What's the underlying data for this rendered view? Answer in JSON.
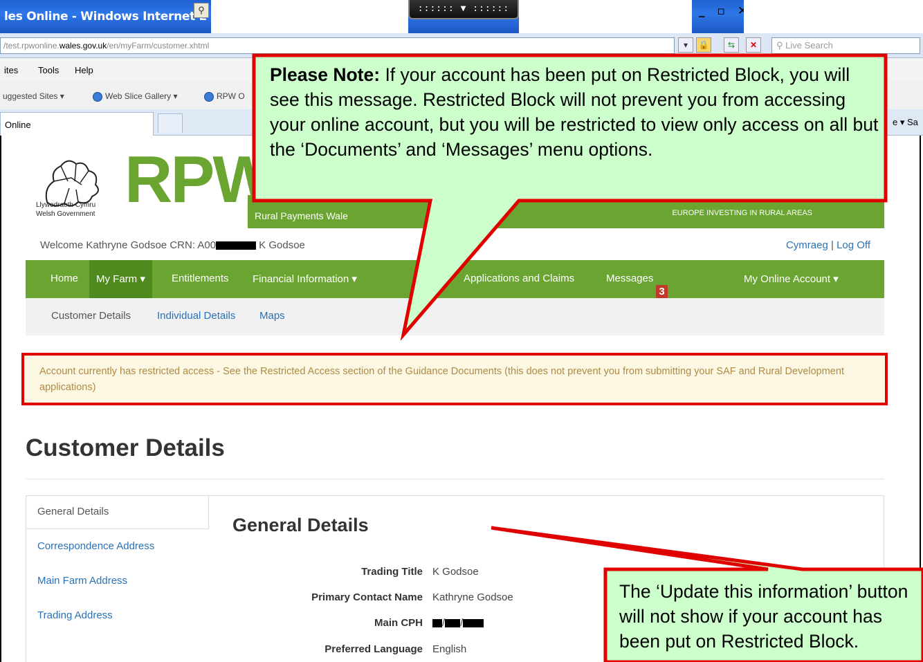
{
  "browser": {
    "window_title": "les Online - Windows Internet E",
    "window_controls": "_ ̈ ×",
    "rdp_bar": ":::::: ▼ ::::::",
    "url_prefix": "/test.rpwonline.",
    "url_domain": "wales.gov.uk",
    "url_suffix": "/en/myFarm/customer.xhtml",
    "search_placeholder": "Live Search",
    "menu": [
      "ites",
      "Tools",
      "Help"
    ],
    "favorites": [
      "uggested Sites ▾",
      "Web Slice Gallery ▾",
      "RPW O"
    ],
    "tab_label": "Online",
    "toolbar_fragment": "e ▾  Sa"
  },
  "site": {
    "logo": "RPW",
    "crest_line1": "Llywodraeth Cymru",
    "crest_line2": "Welsh Government",
    "subtitle": "Rural Payments Wale",
    "europe": "EUROPE INVESTING IN RURAL AREAS",
    "welcome_prefix": "Welcome Kathryne Godsoe CRN: A00",
    "welcome_suffix": " K Godsoe",
    "cymraeg": "Cymraeg",
    "separator": " | ",
    "log_off": "Log Off"
  },
  "nav": {
    "home": "Home",
    "my_farm": "My Farm ▾",
    "entitlements": "Entitlements",
    "financial": "Financial Information ▾",
    "applications": "Applications and Claims",
    "messages": "Messages",
    "messages_count": "3",
    "my_account": "My Online Account ▾"
  },
  "subnav": {
    "customer_details": "Customer Details",
    "individual_details": "Individual Details",
    "maps": "Maps"
  },
  "alert": "Account currently has restricted access - See the Restricted Access section of the Guidance Documents (this does not prevent you from submitting your SAF and Rural Development applications)",
  "page_title": "Customer Details",
  "sidebar": {
    "general": "General Details",
    "correspondence": "Correspondence Address",
    "main_farm": "Main Farm Address",
    "trading": "Trading Address"
  },
  "general": {
    "title": "General Details",
    "fields": [
      {
        "label": "Trading Title",
        "value": "K Godsoe"
      },
      {
        "label": "Primary Contact Name",
        "value": "Kathryne Godsoe"
      },
      {
        "label": "Main CPH",
        "value": ""
      },
      {
        "label": "Preferred Language",
        "value": "English"
      }
    ]
  },
  "callout_top": {
    "bold": "Please Note:",
    "text": "  If your account has been put on Restricted Block, you will see this message.  Restricted Block will not prevent you from accessing your online account, but you will be restricted to view only access on all but the ‘Documents’ and ‘Messages’ menu options."
  },
  "callout_bottom": {
    "text": "The ‘Update this information’ button will not show if your account has been put on Restricted Block."
  },
  "colors": {
    "brand_green": "#6aa531",
    "link_blue": "#2a72b5",
    "callout_fill": "#ccffcc",
    "callout_border": "#e00000"
  }
}
